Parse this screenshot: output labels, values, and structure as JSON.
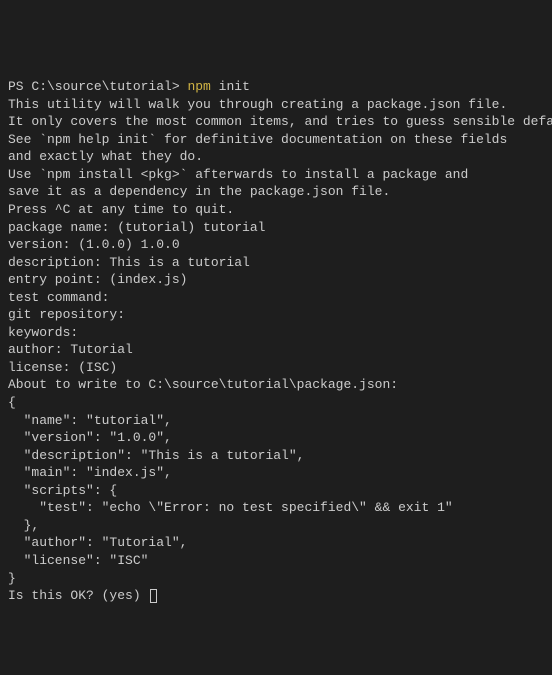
{
  "prompt": {
    "ps": "PS ",
    "path": "C:\\source\\tutorial>",
    "npm": " npm",
    "arg": " init"
  },
  "lines": {
    "intro1": "This utility will walk you through creating a package.json file.",
    "intro2": "It only covers the most common items, and tries to guess sensible defaults.",
    "blank1": "",
    "help1": "See `npm help init` for definitive documentation on these fields",
    "help2": "and exactly what they do.",
    "blank2": "",
    "install1": "Use `npm install <pkg>` afterwards to install a package and",
    "install2": "save it as a dependency in the package.json file.",
    "blank3": "",
    "ctrlc": "Press ^C at any time to quit.",
    "pkgname": "package name: (tutorial) tutorial",
    "version": "version: (1.0.0) 1.0.0",
    "description": "description: This is a tutorial",
    "entrypoint": "entry point: (index.js)",
    "testcmd": "test command:",
    "gitrepo": "git repository:",
    "keywords": "keywords:",
    "author": "author: Tutorial",
    "license": "license: (ISC)",
    "aboutwrite": "About to write to C:\\source\\tutorial\\package.json:",
    "blank4": "",
    "jsonopen": "{",
    "jsonname": "  \"name\": \"tutorial\",",
    "jsonversion": "  \"version\": \"1.0.0\",",
    "jsondesc": "  \"description\": \"This is a tutorial\",",
    "jsonmain": "  \"main\": \"index.js\",",
    "jsonscripts": "  \"scripts\": {",
    "jsontest": "    \"test\": \"echo \\\"Error: no test specified\\\" && exit 1\"",
    "jsonscriptsclose": "  },",
    "jsonauthor": "  \"author\": \"Tutorial\",",
    "jsonlicense": "  \"license\": \"ISC\"",
    "jsonclose": "}",
    "blank5": "",
    "blank6": "",
    "isok": "Is this OK? (yes) "
  }
}
